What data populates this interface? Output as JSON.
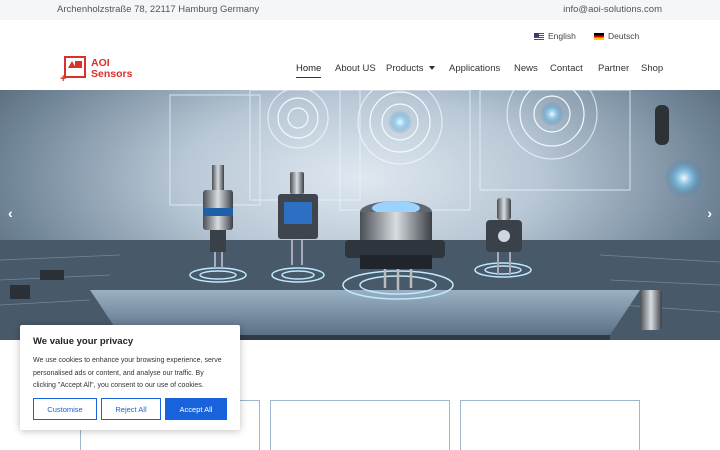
{
  "topbar": {
    "address": "Archenholzstraße 78, 22117 Hamburg Germany",
    "email": "info@aoi-solutions.com"
  },
  "languages": {
    "english": "English",
    "deutsch": "Deutsch"
  },
  "logo": {
    "line1": "AOI",
    "line2": "Sensors"
  },
  "nav": {
    "home": "Home",
    "about": "About US",
    "products": "Products",
    "applications": "Applications",
    "news": "News",
    "contact": "Contact",
    "partner": "Partner",
    "shop": "Shop"
  },
  "hero": {
    "prev": "‹",
    "next": "›"
  },
  "cookie": {
    "title": "We value your privacy",
    "text": "We use cookies to enhance your browsing experience, serve personalised ads or content, and analyse our traffic. By clicking \"Accept All\", you consent to our use of cookies.",
    "customise": "Customise",
    "reject": "Reject All",
    "accept": "Accept All"
  },
  "colors": {
    "brand": "#d9302a",
    "accent": "#1863dc"
  }
}
